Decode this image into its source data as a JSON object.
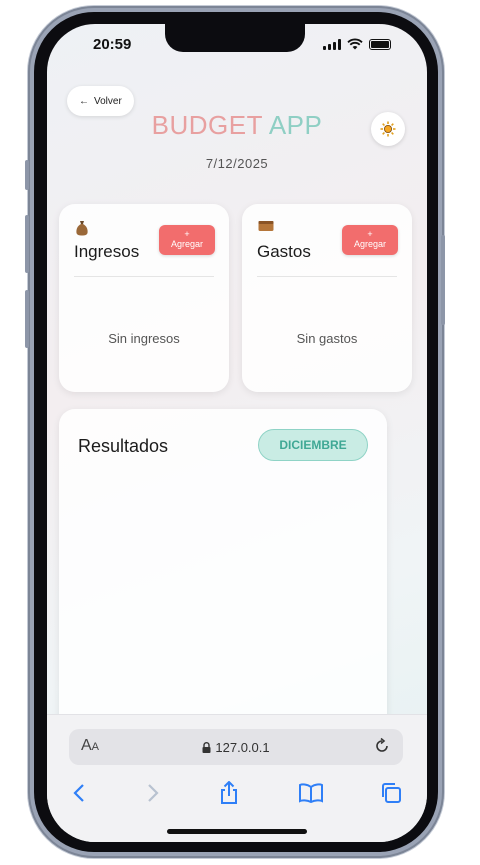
{
  "status": {
    "time": "20:59"
  },
  "header": {
    "back_label": "Volver",
    "title_part1": "BUDGET",
    "title_part2": "APP",
    "date": "7/12/2025"
  },
  "income": {
    "title": "Ingresos",
    "add_symbol": "+",
    "add_label": "Agregar",
    "empty": "Sin ingresos"
  },
  "expenses": {
    "title": "Gastos",
    "add_symbol": "+",
    "add_label": "Agregar",
    "empty": "Sin gastos"
  },
  "results": {
    "title": "Resultados",
    "month": "DICIEMBRE"
  },
  "browser": {
    "text_size_label": "A",
    "text_size_label_small": "A",
    "url": "127.0.0.1"
  },
  "icons": {
    "income": "money-bag-icon",
    "expenses": "wallet-icon",
    "theme": "sun-icon"
  },
  "colors": {
    "accent_red": "#f26d6d",
    "accent_teal": "#3fa895",
    "title_pink": "#e8a0a0",
    "title_teal": "#8fcfc4"
  }
}
